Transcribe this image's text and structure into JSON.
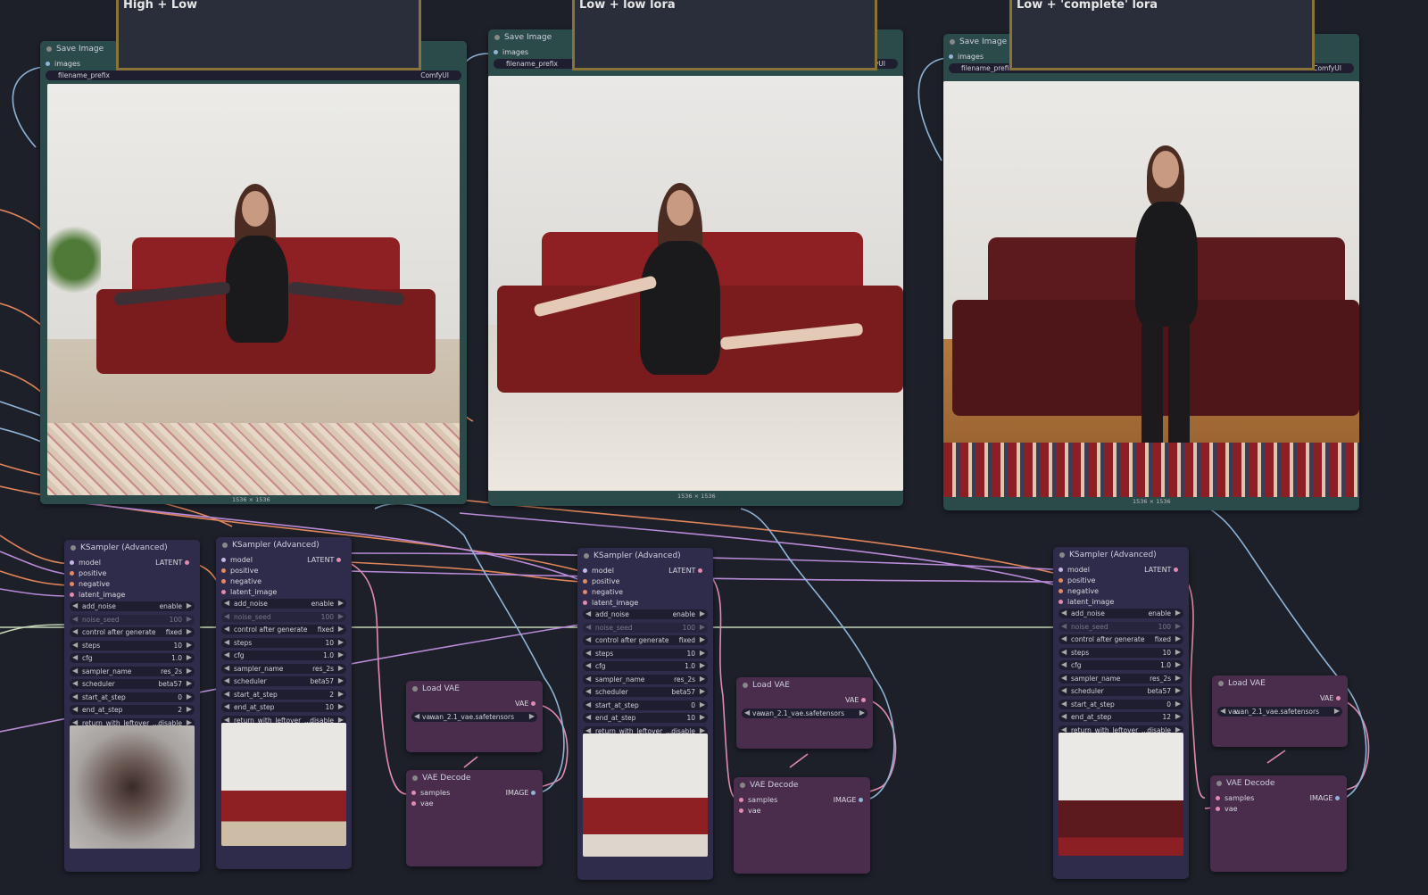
{
  "groups": [
    {
      "title": "High + Low"
    },
    {
      "title": "Low + low lora"
    },
    {
      "title": "Low + 'complete' lora"
    }
  ],
  "save_nodes": [
    {
      "title": "Save Image",
      "input": "images",
      "widget": "filename_prefix",
      "value": "ComfyUI",
      "size": "1536 × 1536"
    },
    {
      "title": "Save Image",
      "input": "images",
      "widget": "filename_prefix",
      "value": "lyUI",
      "size": "1536 × 1536"
    },
    {
      "title": "Save Image",
      "input": "images",
      "widget": "filename_prefix",
      "value": "ComfyUI",
      "size": "1536 × 1536"
    }
  ],
  "ksampler": {
    "title": "KSampler (Advanced)",
    "inputs": [
      "model",
      "positive",
      "negative",
      "latent_image"
    ],
    "output": "LATENT",
    "nodes": [
      {
        "widgets": [
          {
            "name": "add_noise",
            "value": "enable"
          },
          {
            "name": "noise_seed",
            "value": "100"
          },
          {
            "name": "control after generate",
            "value": "fixed"
          },
          {
            "name": "steps",
            "value": "10"
          },
          {
            "name": "cfg",
            "value": "1.0"
          },
          {
            "name": "sampler_name",
            "value": "res_2s"
          },
          {
            "name": "scheduler",
            "value": "beta57"
          },
          {
            "name": "start_at_step",
            "value": "0"
          },
          {
            "name": "end_at_step",
            "value": "2"
          },
          {
            "name": "return_with_leftover_...",
            "value": "disable"
          }
        ]
      },
      {
        "widgets": [
          {
            "name": "add_noise",
            "value": "enable"
          },
          {
            "name": "noise_seed",
            "value": "100"
          },
          {
            "name": "control after generate",
            "value": "fixed"
          },
          {
            "name": "steps",
            "value": "10"
          },
          {
            "name": "cfg",
            "value": "1.0"
          },
          {
            "name": "sampler_name",
            "value": "res_2s"
          },
          {
            "name": "scheduler",
            "value": "beta57"
          },
          {
            "name": "start_at_step",
            "value": "2"
          },
          {
            "name": "end_at_step",
            "value": "10"
          },
          {
            "name": "return_with_leftover_...",
            "value": "disable"
          }
        ]
      },
      {
        "widgets": [
          {
            "name": "add_noise",
            "value": "enable"
          },
          {
            "name": "noise_seed",
            "value": "100"
          },
          {
            "name": "control after generate",
            "value": "fixed"
          },
          {
            "name": "steps",
            "value": "10"
          },
          {
            "name": "cfg",
            "value": "1.0"
          },
          {
            "name": "sampler_name",
            "value": "res_2s"
          },
          {
            "name": "scheduler",
            "value": "beta57"
          },
          {
            "name": "start_at_step",
            "value": "0"
          },
          {
            "name": "end_at_step",
            "value": "10"
          },
          {
            "name": "return_with_leftover_...",
            "value": "disable"
          }
        ]
      },
      {
        "widgets": [
          {
            "name": "add_noise",
            "value": "enable"
          },
          {
            "name": "noise_seed",
            "value": "100"
          },
          {
            "name": "control after generate",
            "value": "fixed"
          },
          {
            "name": "steps",
            "value": "10"
          },
          {
            "name": "cfg",
            "value": "1.0"
          },
          {
            "name": "sampler_name",
            "value": "res_2s"
          },
          {
            "name": "scheduler",
            "value": "beta57"
          },
          {
            "name": "start_at_step",
            "value": "0"
          },
          {
            "name": "end_at_step",
            "value": "12"
          },
          {
            "name": "return_with_leftover_...",
            "value": "disable"
          }
        ]
      }
    ]
  },
  "load_vae": {
    "title": "Load VAE",
    "output": "VAE",
    "widget_label": "va...",
    "value": "wan_2.1_vae.safetensors"
  },
  "vae_decode": {
    "title": "VAE Decode",
    "inputs": [
      "samples",
      "vae"
    ],
    "output": "IMAGE"
  },
  "colors": {
    "group_border": "#8a7339",
    "canvas": "#1d2029",
    "wire_orange": "#e0845a",
    "wire_purple": "#b98ad8",
    "wire_blue": "#8fb4d8",
    "wire_green": "#c5d6b8",
    "wire_pink": "#e28ab0"
  }
}
